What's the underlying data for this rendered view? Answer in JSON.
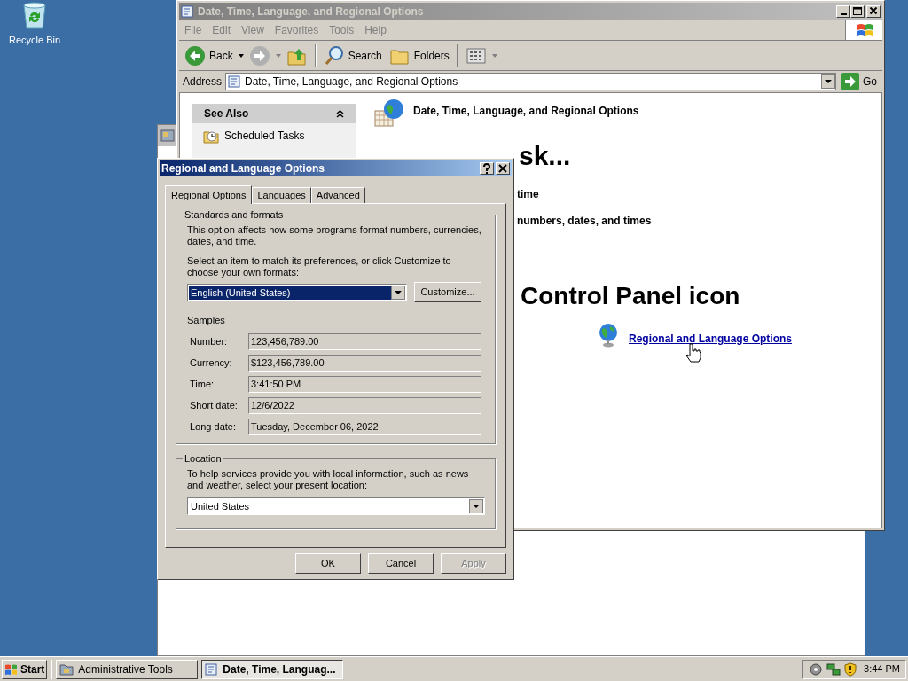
{
  "desktop_icons": [
    {
      "label": "Recycle Bin"
    }
  ],
  "explorer": {
    "title": "Date, Time, Language, and Regional Options",
    "active": false,
    "menu": [
      "File",
      "Edit",
      "View",
      "Favorites",
      "Tools",
      "Help"
    ],
    "toolbar": [
      {
        "kind": "back",
        "label": "Back"
      },
      {
        "kind": "forward"
      },
      {
        "kind": "up"
      },
      {
        "kind": "search",
        "label": "Search"
      },
      {
        "kind": "folders",
        "label": "Folders"
      },
      {
        "kind": "views"
      }
    ],
    "address": {
      "label": "Address",
      "value": "Date, Time, Language, and Regional Options",
      "go": "Go"
    },
    "see_also": {
      "title": "See Also",
      "items": [
        "Scheduled Tasks"
      ]
    },
    "content": {
      "category_title": "Date, Time, Language, and Regional Options",
      "heading_fragment": "sk...",
      "task_fragments": [
        "time",
        "numbers, dates, and times"
      ],
      "icon_heading_fragment": "Control Panel icon",
      "link": "Regional and Language Options"
    }
  },
  "dialog": {
    "title": "Regional and Language Options",
    "active": true,
    "tabs": [
      {
        "label": "Regional Options",
        "selected": true
      },
      {
        "label": "Languages",
        "selected": false
      },
      {
        "label": "Advanced",
        "selected": false
      }
    ],
    "standards": {
      "legend": "Standards and formats",
      "description": "This option affects how some programs format numbers, currencies, dates, and time.",
      "instruction": "Select an item to match its preferences, or click Customize to choose your own formats:",
      "format_value": "English (United States)",
      "customize": "Customize..."
    },
    "samples": {
      "legend": "Samples",
      "rows": [
        {
          "label": "Number:",
          "value": "123,456,789.00"
        },
        {
          "label": "Currency:",
          "value": "$123,456,789.00"
        },
        {
          "label": "Time:",
          "value": "3:41:50 PM"
        },
        {
          "label": "Short date:",
          "value": "12/6/2022"
        },
        {
          "label": "Long date:",
          "value": "Tuesday, December 06, 2022"
        }
      ]
    },
    "location": {
      "legend": "Location",
      "description": "To help services provide you with local information, such as news and weather, select your present location:",
      "value": "United States"
    },
    "buttons": [
      {
        "label": "OK",
        "disabled": false
      },
      {
        "label": "Cancel",
        "disabled": false
      },
      {
        "label": "Apply",
        "disabled": true
      }
    ]
  },
  "taskbar": {
    "start": "Start",
    "tasks": [
      {
        "label": "Administrative Tools",
        "selected": false
      },
      {
        "label": "Date, Time, Languag...",
        "selected": true
      }
    ],
    "clock": "3:44 PM"
  }
}
